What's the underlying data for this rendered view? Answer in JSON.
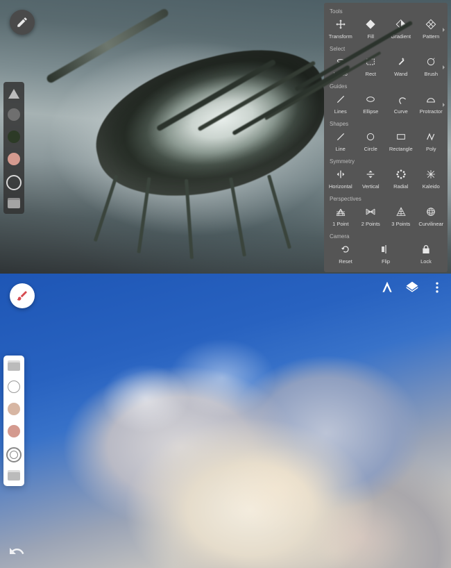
{
  "top": {
    "fab_icon": "brush-active-icon",
    "sidebar": {
      "items": [
        {
          "name": "shape-tool",
          "type": "triangle"
        },
        {
          "name": "color-1",
          "type": "swatch",
          "color": "#6f6f6f"
        },
        {
          "name": "color-2",
          "type": "swatch",
          "color": "#2c3a26"
        },
        {
          "name": "color-3",
          "type": "swatch",
          "color": "#d49a8f"
        },
        {
          "name": "brush-ring",
          "type": "ring"
        },
        {
          "name": "layers",
          "type": "stack"
        }
      ]
    },
    "panel": {
      "sections": [
        {
          "label": "Tools",
          "caret": true,
          "items": [
            {
              "name": "transform",
              "label": "Transform",
              "icon": "move-icon"
            },
            {
              "name": "fill",
              "label": "Fill",
              "icon": "diamond-fill-icon"
            },
            {
              "name": "gradient",
              "label": "Gradient",
              "icon": "diamond-half-icon"
            },
            {
              "name": "pattern",
              "label": "Pattern",
              "icon": "diamond-pattern-icon"
            }
          ]
        },
        {
          "label": "Select",
          "caret": true,
          "items": [
            {
              "name": "lasso",
              "label": "Lasso",
              "icon": "lasso-icon"
            },
            {
              "name": "rect-select",
              "label": "Rect",
              "icon": "rect-dashed-icon"
            },
            {
              "name": "wand",
              "label": "Wand",
              "icon": "wand-icon"
            },
            {
              "name": "brush-select",
              "label": "Brush",
              "icon": "brush-circle-icon"
            }
          ]
        },
        {
          "label": "Guides",
          "caret": true,
          "items": [
            {
              "name": "lines",
              "label": "Lines",
              "icon": "line-diag-icon"
            },
            {
              "name": "ellipse",
              "label": "Ellipse",
              "icon": "ellipse-icon"
            },
            {
              "name": "curve",
              "label": "Curve",
              "icon": "curve-icon"
            },
            {
              "name": "protractor",
              "label": "Protractor",
              "icon": "protractor-icon"
            }
          ]
        },
        {
          "label": "Shapes",
          "caret": false,
          "items": [
            {
              "name": "line-shape",
              "label": "Line",
              "icon": "line-diag-icon"
            },
            {
              "name": "circle-shape",
              "label": "Circle",
              "icon": "circle-icon"
            },
            {
              "name": "rectangle-shape",
              "label": "Rectangle",
              "icon": "rectangle-icon"
            },
            {
              "name": "poly-shape",
              "label": "Poly",
              "icon": "poly-icon"
            }
          ]
        },
        {
          "label": "Symmetry",
          "caret": false,
          "items": [
            {
              "name": "sym-horizontal",
              "label": "Horizontal",
              "icon": "sym-h-icon"
            },
            {
              "name": "sym-vertical",
              "label": "Vertical",
              "icon": "sym-v-icon"
            },
            {
              "name": "sym-radial",
              "label": "Radial",
              "icon": "sym-radial-icon"
            },
            {
              "name": "sym-kaleido",
              "label": "Kaleido",
              "icon": "sym-kaleido-icon"
            }
          ]
        },
        {
          "label": "Perspectives",
          "caret": false,
          "items": [
            {
              "name": "persp-1",
              "label": "1 Point",
              "icon": "grid-1pt-icon"
            },
            {
              "name": "persp-2",
              "label": "2 Points",
              "icon": "grid-2pt-icon"
            },
            {
              "name": "persp-3",
              "label": "3 Points",
              "icon": "grid-3pt-icon"
            },
            {
              "name": "persp-curv",
              "label": "Curvilinear",
              "icon": "globe-grid-icon"
            }
          ]
        },
        {
          "label": "Camera",
          "caret": false,
          "items": [
            {
              "name": "cam-reset",
              "label": "Reset",
              "icon": "reset-icon"
            },
            {
              "name": "cam-flip",
              "label": "Flip",
              "icon": "flip-icon"
            },
            {
              "name": "cam-lock",
              "label": "Lock",
              "icon": "lock-icon"
            }
          ]
        }
      ]
    }
  },
  "bottom": {
    "fab_icon": "brush-icon",
    "accent": "#d6494e",
    "topbar": {
      "items": [
        {
          "name": "guides-toggle",
          "icon": "compass-icon"
        },
        {
          "name": "layers-button",
          "icon": "layers-icon"
        },
        {
          "name": "overflow-menu",
          "icon": "more-vert-icon"
        }
      ]
    },
    "sidebar": {
      "items": [
        {
          "name": "layers",
          "type": "stack-light"
        },
        {
          "name": "color-outline",
          "type": "swatch-outline"
        },
        {
          "name": "color-1",
          "type": "swatch",
          "color": "#d7b6a3"
        },
        {
          "name": "color-2",
          "type": "swatch",
          "color": "#d49a8f"
        },
        {
          "name": "brush-ring",
          "type": "ring2"
        },
        {
          "name": "stack2",
          "type": "stack-light"
        }
      ]
    },
    "undo_icon": "undo-icon"
  }
}
